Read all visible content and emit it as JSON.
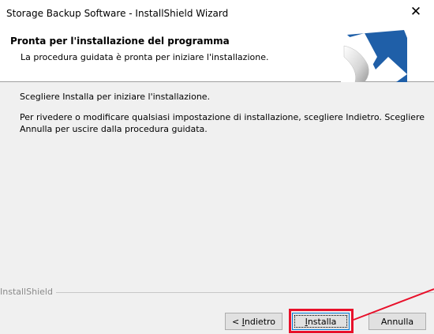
{
  "window": {
    "title": "Storage Backup Software - InstallShield Wizard",
    "close_glyph": "✕"
  },
  "header": {
    "title": "Pronta per l'installazione del programma",
    "subtitle": "La procedura guidata è pronta per iniziare l'installazione.",
    "logo_icon": "installshield-logo-icon"
  },
  "body": {
    "paragraph1": "Scegliere Installa per iniziare l'installazione.",
    "paragraph2": "Per rivedere o modificare qualsiasi impostazione di installazione, scegliere Indietro. Scegliere Annulla per uscire dalla procedura guidata."
  },
  "footer": {
    "brand": "InstallShield"
  },
  "buttons": {
    "back_prefix": "< ",
    "back_mnemonic": "I",
    "back_rest": "ndietro",
    "install_mnemonic": "I",
    "install_rest": "nstalla",
    "cancel": "Annulla"
  },
  "colors": {
    "annotation": "#e8102a",
    "logo_blue": "#1f5fa8",
    "focus_border": "#0078d7"
  }
}
